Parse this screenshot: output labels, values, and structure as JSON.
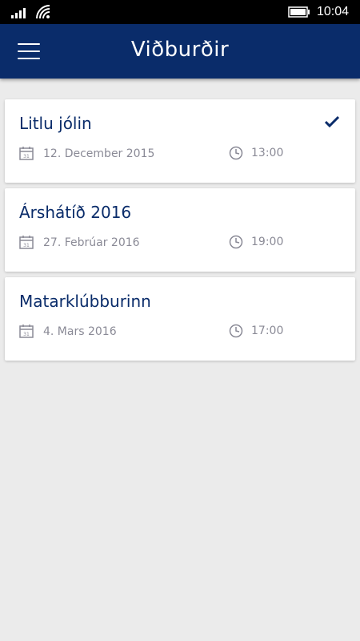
{
  "status_bar": {
    "time": "10:04",
    "icons": [
      "signal-icon",
      "wifi-icon",
      "battery-icon"
    ]
  },
  "app_bar": {
    "title": "Viðburðir",
    "menu_icon": "hamburger-menu-icon",
    "background_color": "#0a2c6a"
  },
  "events": [
    {
      "title": "Litlu jólin",
      "date": "12. December 2015",
      "time": "13:00",
      "checked": true
    },
    {
      "title": "Árshátíð 2016",
      "date": "27. Febrúar 2016",
      "time": "19:00",
      "checked": false
    },
    {
      "title": "Matarklúbburinn",
      "date": "4. Mars 2016",
      "time": "17:00",
      "checked": false
    }
  ],
  "colors": {
    "accent": "#0a2c6a",
    "meta_text": "#8a8a96",
    "background": "#ebebeb"
  }
}
